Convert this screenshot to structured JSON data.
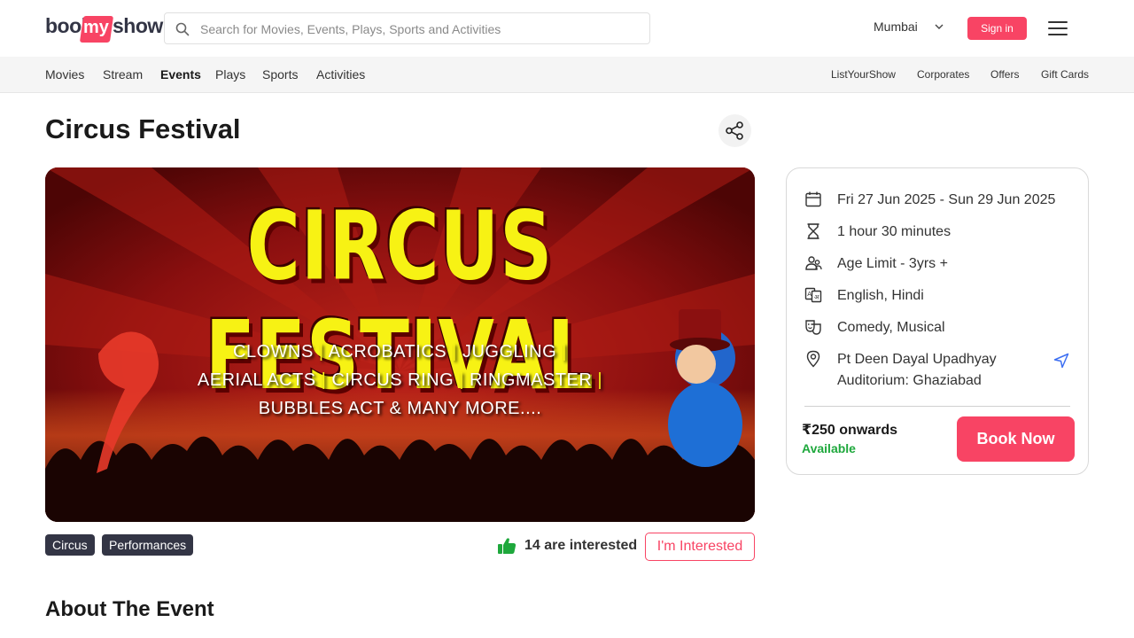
{
  "header": {
    "logo": {
      "part1": "book",
      "part2": "my",
      "part3": "show"
    },
    "search": {
      "placeholder": "Search for Movies, Events, Plays, Sports and Activities",
      "value": ""
    },
    "city": "Mumbai",
    "sign_in_label": "Sign in"
  },
  "subnav": {
    "left": [
      "Movies",
      "Stream",
      "Events",
      "Plays",
      "Sports",
      "Activities"
    ],
    "active": "Events",
    "right": [
      "ListYourShow",
      "Corporates",
      "Offers",
      "Gift Cards"
    ]
  },
  "event": {
    "title": "Circus Festival",
    "banner": {
      "headline": "CIRCUS FESTIVAL",
      "line1": [
        "CLOWNS",
        "ACROBATICS",
        "JUGGLING"
      ],
      "line2": [
        "AERIAL ACTS",
        "CIRCUS RING",
        "RINGMASTER"
      ],
      "line3": "BUBBLES ACT & MANY MORE...."
    },
    "tags": [
      "Circus",
      "Performances"
    ],
    "interested_count_text": "14 are interested",
    "interested_button_label": "I'm Interested",
    "about_heading": "About The Event"
  },
  "details": {
    "date": "Fri 27 Jun 2025 - Sun 29 Jun 2025",
    "duration": "1 hour 30 minutes",
    "age_limit": "Age Limit - 3yrs +",
    "languages": "English, Hindi",
    "genres": "Comedy, Musical",
    "venue_line1": "Pt Deen Dayal Upadhyay",
    "venue_line2": "Auditorium: Ghaziabad",
    "price": "₹250 onwards",
    "availability": "Available",
    "book_label": "Book Now"
  },
  "colors": {
    "brand": "#f84464",
    "dark_tag": "#333545",
    "available_green": "#1ea83c",
    "headline_yellow": "#f7f214"
  },
  "icons": [
    "search-icon",
    "chevron-down-icon",
    "menu-icon",
    "share-icon",
    "calendar-icon",
    "hourglass-icon",
    "people-icon",
    "language-icon",
    "theater-masks-icon",
    "location-pin-icon",
    "navigate-icon",
    "thumbs-up-icon"
  ]
}
